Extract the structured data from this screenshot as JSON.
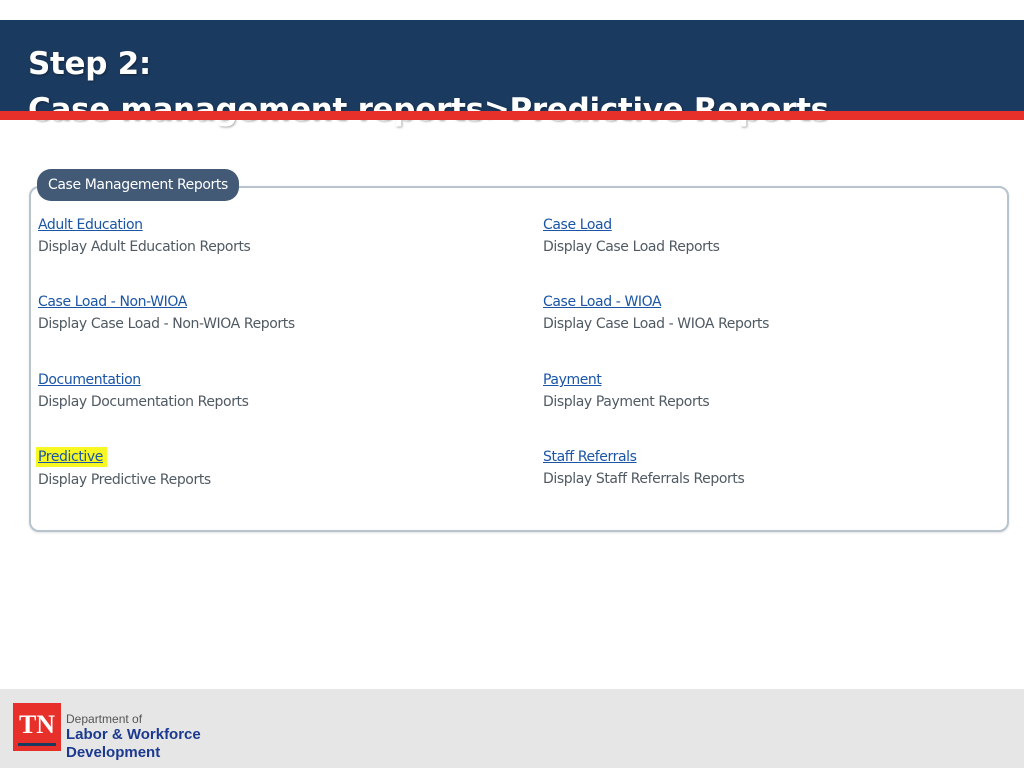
{
  "slide": {
    "title_line1": "Step 2:",
    "title_line2": "Case management reports>Predictive Reports"
  },
  "panel": {
    "heading": "Case Management Reports",
    "reports": [
      {
        "label": "Adult Education",
        "description": "Display Adult Education Reports"
      },
      {
        "label": "Case Load",
        "description": "Display Case Load Reports"
      },
      {
        "label": "Case Load - Non-WIOA",
        "description": "Display Case Load - Non-WIOA Reports"
      },
      {
        "label": "Case Load - WIOA",
        "description": "Display Case Load - WIOA Reports"
      },
      {
        "label": "Documentation",
        "description": "Display Documentation Reports"
      },
      {
        "label": "Payment",
        "description": "Display Payment Reports"
      },
      {
        "label": "Predictive",
        "description": "Display Predictive Reports",
        "highlighted": true
      },
      {
        "label": "Staff Referrals",
        "description": "Display Staff Referrals Reports"
      }
    ]
  },
  "footer": {
    "logo_text": "TN",
    "dept_line1": "Department of",
    "dept_line2": "Labor & Workforce",
    "dept_line3": "Development"
  },
  "colors": {
    "header_bg": "#1b3a5f",
    "accent_red": "#e8302b",
    "link_blue": "#1a55a6",
    "highlight_yellow": "#f7f722"
  }
}
